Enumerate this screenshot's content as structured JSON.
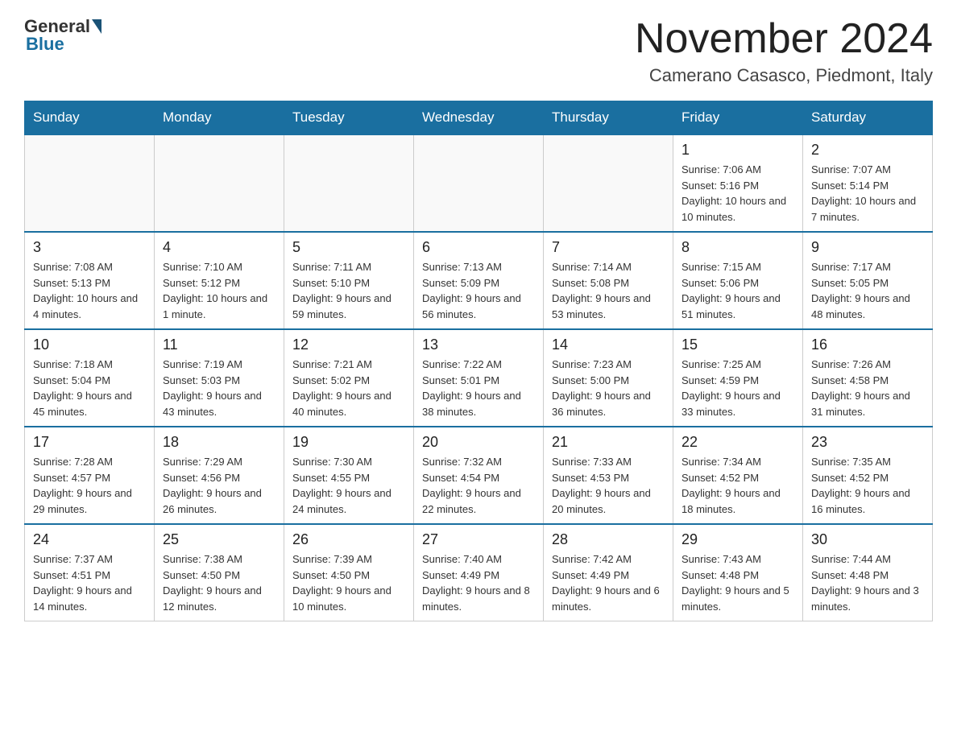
{
  "header": {
    "logo_general": "General",
    "logo_blue": "Blue",
    "month_title": "November 2024",
    "location": "Camerano Casasco, Piedmont, Italy"
  },
  "weekdays": [
    "Sunday",
    "Monday",
    "Tuesday",
    "Wednesday",
    "Thursday",
    "Friday",
    "Saturday"
  ],
  "weeks": [
    [
      {
        "day": "",
        "info": ""
      },
      {
        "day": "",
        "info": ""
      },
      {
        "day": "",
        "info": ""
      },
      {
        "day": "",
        "info": ""
      },
      {
        "day": "",
        "info": ""
      },
      {
        "day": "1",
        "info": "Sunrise: 7:06 AM\nSunset: 5:16 PM\nDaylight: 10 hours\nand 10 minutes."
      },
      {
        "day": "2",
        "info": "Sunrise: 7:07 AM\nSunset: 5:14 PM\nDaylight: 10 hours\nand 7 minutes."
      }
    ],
    [
      {
        "day": "3",
        "info": "Sunrise: 7:08 AM\nSunset: 5:13 PM\nDaylight: 10 hours\nand 4 minutes."
      },
      {
        "day": "4",
        "info": "Sunrise: 7:10 AM\nSunset: 5:12 PM\nDaylight: 10 hours\nand 1 minute."
      },
      {
        "day": "5",
        "info": "Sunrise: 7:11 AM\nSunset: 5:10 PM\nDaylight: 9 hours\nand 59 minutes."
      },
      {
        "day": "6",
        "info": "Sunrise: 7:13 AM\nSunset: 5:09 PM\nDaylight: 9 hours\nand 56 minutes."
      },
      {
        "day": "7",
        "info": "Sunrise: 7:14 AM\nSunset: 5:08 PM\nDaylight: 9 hours\nand 53 minutes."
      },
      {
        "day": "8",
        "info": "Sunrise: 7:15 AM\nSunset: 5:06 PM\nDaylight: 9 hours\nand 51 minutes."
      },
      {
        "day": "9",
        "info": "Sunrise: 7:17 AM\nSunset: 5:05 PM\nDaylight: 9 hours\nand 48 minutes."
      }
    ],
    [
      {
        "day": "10",
        "info": "Sunrise: 7:18 AM\nSunset: 5:04 PM\nDaylight: 9 hours\nand 45 minutes."
      },
      {
        "day": "11",
        "info": "Sunrise: 7:19 AM\nSunset: 5:03 PM\nDaylight: 9 hours\nand 43 minutes."
      },
      {
        "day": "12",
        "info": "Sunrise: 7:21 AM\nSunset: 5:02 PM\nDaylight: 9 hours\nand 40 minutes."
      },
      {
        "day": "13",
        "info": "Sunrise: 7:22 AM\nSunset: 5:01 PM\nDaylight: 9 hours\nand 38 minutes."
      },
      {
        "day": "14",
        "info": "Sunrise: 7:23 AM\nSunset: 5:00 PM\nDaylight: 9 hours\nand 36 minutes."
      },
      {
        "day": "15",
        "info": "Sunrise: 7:25 AM\nSunset: 4:59 PM\nDaylight: 9 hours\nand 33 minutes."
      },
      {
        "day": "16",
        "info": "Sunrise: 7:26 AM\nSunset: 4:58 PM\nDaylight: 9 hours\nand 31 minutes."
      }
    ],
    [
      {
        "day": "17",
        "info": "Sunrise: 7:28 AM\nSunset: 4:57 PM\nDaylight: 9 hours\nand 29 minutes."
      },
      {
        "day": "18",
        "info": "Sunrise: 7:29 AM\nSunset: 4:56 PM\nDaylight: 9 hours\nand 26 minutes."
      },
      {
        "day": "19",
        "info": "Sunrise: 7:30 AM\nSunset: 4:55 PM\nDaylight: 9 hours\nand 24 minutes."
      },
      {
        "day": "20",
        "info": "Sunrise: 7:32 AM\nSunset: 4:54 PM\nDaylight: 9 hours\nand 22 minutes."
      },
      {
        "day": "21",
        "info": "Sunrise: 7:33 AM\nSunset: 4:53 PM\nDaylight: 9 hours\nand 20 minutes."
      },
      {
        "day": "22",
        "info": "Sunrise: 7:34 AM\nSunset: 4:52 PM\nDaylight: 9 hours\nand 18 minutes."
      },
      {
        "day": "23",
        "info": "Sunrise: 7:35 AM\nSunset: 4:52 PM\nDaylight: 9 hours\nand 16 minutes."
      }
    ],
    [
      {
        "day": "24",
        "info": "Sunrise: 7:37 AM\nSunset: 4:51 PM\nDaylight: 9 hours\nand 14 minutes."
      },
      {
        "day": "25",
        "info": "Sunrise: 7:38 AM\nSunset: 4:50 PM\nDaylight: 9 hours\nand 12 minutes."
      },
      {
        "day": "26",
        "info": "Sunrise: 7:39 AM\nSunset: 4:50 PM\nDaylight: 9 hours\nand 10 minutes."
      },
      {
        "day": "27",
        "info": "Sunrise: 7:40 AM\nSunset: 4:49 PM\nDaylight: 9 hours\nand 8 minutes."
      },
      {
        "day": "28",
        "info": "Sunrise: 7:42 AM\nSunset: 4:49 PM\nDaylight: 9 hours\nand 6 minutes."
      },
      {
        "day": "29",
        "info": "Sunrise: 7:43 AM\nSunset: 4:48 PM\nDaylight: 9 hours\nand 5 minutes."
      },
      {
        "day": "30",
        "info": "Sunrise: 7:44 AM\nSunset: 4:48 PM\nDaylight: 9 hours\nand 3 minutes."
      }
    ]
  ]
}
